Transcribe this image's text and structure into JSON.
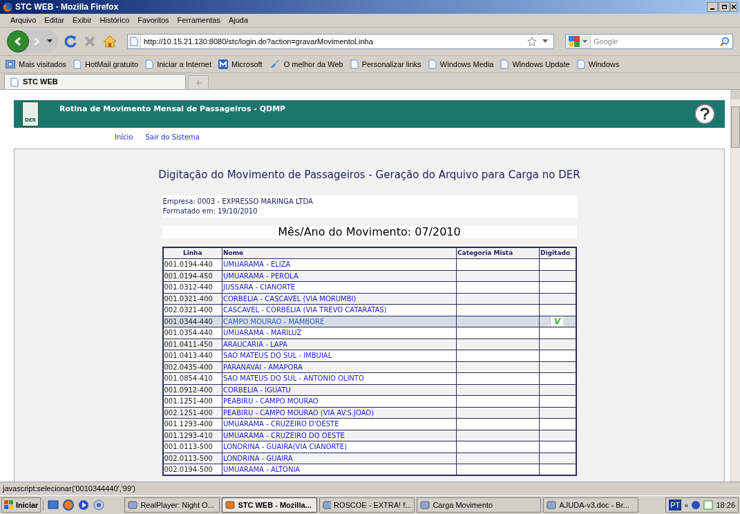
{
  "window": {
    "title": "STC WEB - Mozilla Firefox"
  },
  "menu": [
    "Arquivo",
    "Editar",
    "Exibir",
    "Histórico",
    "Favoritos",
    "Ferramentas",
    "Ajuda"
  ],
  "address": {
    "value": "http://10.15.21.130:8080/stc/login.do?action=gravarMovimentoLinha"
  },
  "search": {
    "placeholder": "Google"
  },
  "bookmarks": [
    {
      "label": "Mais visitados",
      "kind": "folder"
    },
    {
      "label": "HotMail gratuito",
      "kind": "page"
    },
    {
      "label": "Iniciar a Internet",
      "kind": "page"
    },
    {
      "label": "Microsoft",
      "kind": "ms"
    },
    {
      "label": "O melhor da Web",
      "kind": "web"
    },
    {
      "label": "Personalizar links",
      "kind": "page"
    },
    {
      "label": "Windows Media",
      "kind": "page"
    },
    {
      "label": "Windows Update",
      "kind": "page"
    },
    {
      "label": "Windows",
      "kind": "page"
    }
  ],
  "tabs": [
    {
      "label": "STC WEB",
      "selected": true
    }
  ],
  "app": {
    "title": "Rotina de Movimento Mensal de Passageiros - QDMP",
    "logo_text": "DER",
    "links": [
      "Início",
      "Sair do Sistema"
    ]
  },
  "page": {
    "heading": "Digitação do Movimento de Passageiros - Geração do Arquivo para Carga no DER",
    "empresa": "Empresa: 0003 - EXPRESSO MARINGA LTDA",
    "formatado": "Formatado em: 19/10/2010",
    "mes_ano": "Mês/Ano do Movimento: 07/2010"
  },
  "table": {
    "columns": [
      "Linha",
      "Nome",
      "Categoria Mista",
      "Digitado"
    ],
    "rows": [
      {
        "linha": "001.0194-440",
        "nome": "UMUARAMA - ELIZA",
        "selected": false
      },
      {
        "linha": "001.0194-450",
        "nome": "UMUARAMA - PEROLA",
        "selected": false
      },
      {
        "linha": "001.0312-440",
        "nome": "JUSSARA - CIANORTE",
        "selected": false
      },
      {
        "linha": "001.0321-400",
        "nome": "CORBELIA - CASCAVEL (VIA MORUMBI)",
        "selected": false
      },
      {
        "linha": "002.0321-400",
        "nome": "CASCAVEL - CORBELIA (VIA TREVO CATARATAS)",
        "selected": false
      },
      {
        "linha": "001.0344-440",
        "nome": "CAMPO MOURAO - MAMBORE",
        "selected": true,
        "digitado": "V"
      },
      {
        "linha": "001.0354-440",
        "nome": "UMUARAMA - MARILUZ",
        "selected": false
      },
      {
        "linha": "001.0411-450",
        "nome": "ARAUCARIA - LAPA",
        "selected": false
      },
      {
        "linha": "001.0413-440",
        "nome": "SAO MATEUS DO SUL - IMBUIAL",
        "selected": false
      },
      {
        "linha": "002.0435-400",
        "nome": "PARANAVAI - AMAPORA",
        "selected": false
      },
      {
        "linha": "001.0854-410",
        "nome": "SAO MATEUS DO SUL - ANTONIO OLINTO",
        "selected": false
      },
      {
        "linha": "001.0912-400",
        "nome": "CORBELIA - IGUATU",
        "selected": false
      },
      {
        "linha": "001.1251-400",
        "nome": "PEABIRU - CAMPO MOURAO",
        "selected": false
      },
      {
        "linha": "002.1251-400",
        "nome": "PEABIRU - CAMPO MOURAO (VIA AV.S.JOAO)",
        "selected": false
      },
      {
        "linha": "001.1293-400",
        "nome": "UMUARAMA - CRUZEIRO D'OESTE",
        "selected": false
      },
      {
        "linha": "001.1293-410",
        "nome": "UMUARAMA - CRUZEIRO DO OESTE",
        "selected": false
      },
      {
        "linha": "001.0113-500",
        "nome": "LONDRINA - GUAIRA(VIA CIANORTE)",
        "selected": false
      },
      {
        "linha": "002.0113-500",
        "nome": "LONDRINA - GUAIRA",
        "selected": false
      },
      {
        "linha": "002.0194-500",
        "nome": "UMUARAMA - ALTONIA",
        "selected": false
      }
    ]
  },
  "status_bar": "javascript:selecionar('0010344440','99')",
  "taskbar": {
    "start": "Iniciar",
    "tasks": [
      {
        "label": "RealPlayer: Night O...",
        "selected": false
      },
      {
        "label": "STC WEB - Mozilla...",
        "selected": true
      },
      {
        "label": "ROSCOE - EXTRA! f...",
        "selected": false
      },
      {
        "label": "Carga Movimento",
        "selected": false
      },
      {
        "label": "AJUDA-v3.doc - Br...",
        "selected": false
      }
    ],
    "language": "PT",
    "chevron": "«",
    "clock": "18:26"
  }
}
